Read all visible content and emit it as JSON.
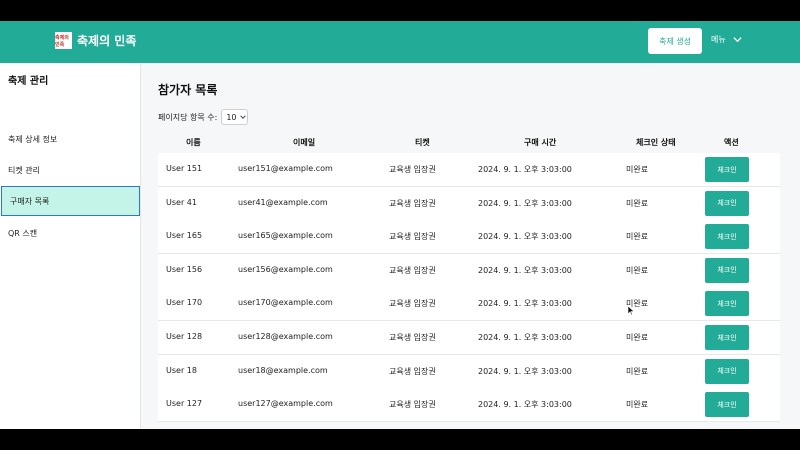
{
  "header": {
    "logo_text": "축제의민족",
    "brand_name": "축제의 민족",
    "create_button": "축제 생성",
    "menu_label": "메뉴"
  },
  "sidebar": {
    "title": "축제 관리",
    "items": [
      {
        "label": "축제 상세 정보",
        "active": false
      },
      {
        "label": "티켓 관리",
        "active": false
      },
      {
        "label": "구매자 목록",
        "active": true
      },
      {
        "label": "QR 스캔",
        "active": false
      }
    ]
  },
  "main": {
    "title": "참가자 목록",
    "per_page_label": "페이지당 항목 수:",
    "per_page_value": "10",
    "columns": [
      "이름",
      "이메일",
      "티켓",
      "구매 시간",
      "체크인 상태",
      "액션"
    ],
    "rows": [
      {
        "name": "User 151",
        "email": "user151@example.com",
        "ticket": "교육생 입장권",
        "time": "2024. 9. 1. 오후 3:03:00",
        "status": "미완료",
        "action": "체크인"
      },
      {
        "name": "User 41",
        "email": "user41@example.com",
        "ticket": "교육생 입장권",
        "time": "2024. 9. 1. 오후 3:03:00",
        "status": "미완료",
        "action": "체크인"
      },
      {
        "name": "User 165",
        "email": "user165@example.com",
        "ticket": "교육생 입장권",
        "time": "2024. 9. 1. 오후 3:03:00",
        "status": "미완료",
        "action": "체크인"
      },
      {
        "name": "User 156",
        "email": "user156@example.com",
        "ticket": "교육생 입장권",
        "time": "2024. 9. 1. 오후 3:03:00",
        "status": "미완료",
        "action": "체크인"
      },
      {
        "name": "User 170",
        "email": "user170@example.com",
        "ticket": "교육생 입장권",
        "time": "2024. 9. 1. 오후 3:03:00",
        "status": "미완료",
        "action": "체크인"
      },
      {
        "name": "User 128",
        "email": "user128@example.com",
        "ticket": "교육생 입장권",
        "time": "2024. 9. 1. 오후 3:03:00",
        "status": "미완료",
        "action": "체크인"
      },
      {
        "name": "User 18",
        "email": "user18@example.com",
        "ticket": "교육생 입장권",
        "time": "2024. 9. 1. 오후 3:03:00",
        "status": "미완료",
        "action": "체크인"
      },
      {
        "name": "User 127",
        "email": "user127@example.com",
        "ticket": "교육생 입장권",
        "time": "2024. 9. 1. 오후 3:03:00",
        "status": "미완료",
        "action": "체크인"
      }
    ]
  },
  "colors": {
    "brand": "#22ac97",
    "active_item_bg": "#c4f4e8",
    "active_item_border": "#2b78c5"
  },
  "icons": {
    "menu": "chevron-down-icon",
    "cursor": "mouse-pointer-icon"
  }
}
